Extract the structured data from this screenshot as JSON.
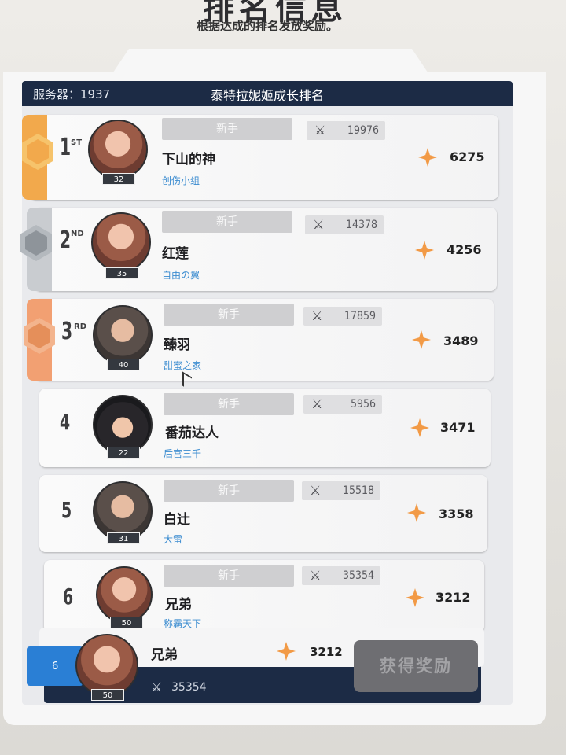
{
  "page": {
    "title": "排名信息",
    "subtitle": "根据达成的排名发放奖励。"
  },
  "header": {
    "server": "服务器：1937",
    "ranking_title": "泰特拉妮姬成长排名"
  },
  "colors": {
    "header_bg": "#1c2b45",
    "gold": "#f2a94c",
    "silver": "#9aa0a6",
    "bronze": "#f2a072",
    "star": "#f29a46",
    "guild_text": "#3b8cd0",
    "self_rank_bg": "#2a7fd5"
  },
  "rows": [
    {
      "rank": "1",
      "suffix": "ST",
      "level": "32",
      "title": "新手",
      "power": "19976",
      "name": "下山的神",
      "guild": "创伤小组",
      "score": "6275"
    },
    {
      "rank": "2",
      "suffix": "ND",
      "level": "35",
      "title": "新手",
      "power": "14378",
      "name": "红莲",
      "guild": "自由の翼",
      "score": "4256"
    },
    {
      "rank": "3",
      "suffix": "RD",
      "level": "40",
      "title": "新手",
      "power": "17859",
      "name": "臻羽",
      "guild": "甜蜜之家",
      "score": "3489"
    },
    {
      "rank": "4",
      "suffix": "",
      "level": "22",
      "title": "新手",
      "power": "5956",
      "name": "番茄达人",
      "guild": "后宫三千",
      "score": "3471"
    },
    {
      "rank": "5",
      "suffix": "",
      "level": "31",
      "title": "新手",
      "power": "15518",
      "name": "白辻",
      "guild": "大雷",
      "score": "3358"
    },
    {
      "rank": "6",
      "suffix": "",
      "level": "50",
      "title": "新手",
      "power": "35354",
      "name": "兄弟",
      "guild": "称霸天下",
      "score": "3212"
    }
  ],
  "self": {
    "rank": "6",
    "name": "兄弟",
    "score": "3212",
    "level": "50",
    "power": "35354"
  },
  "claim_button": "获得奖励"
}
